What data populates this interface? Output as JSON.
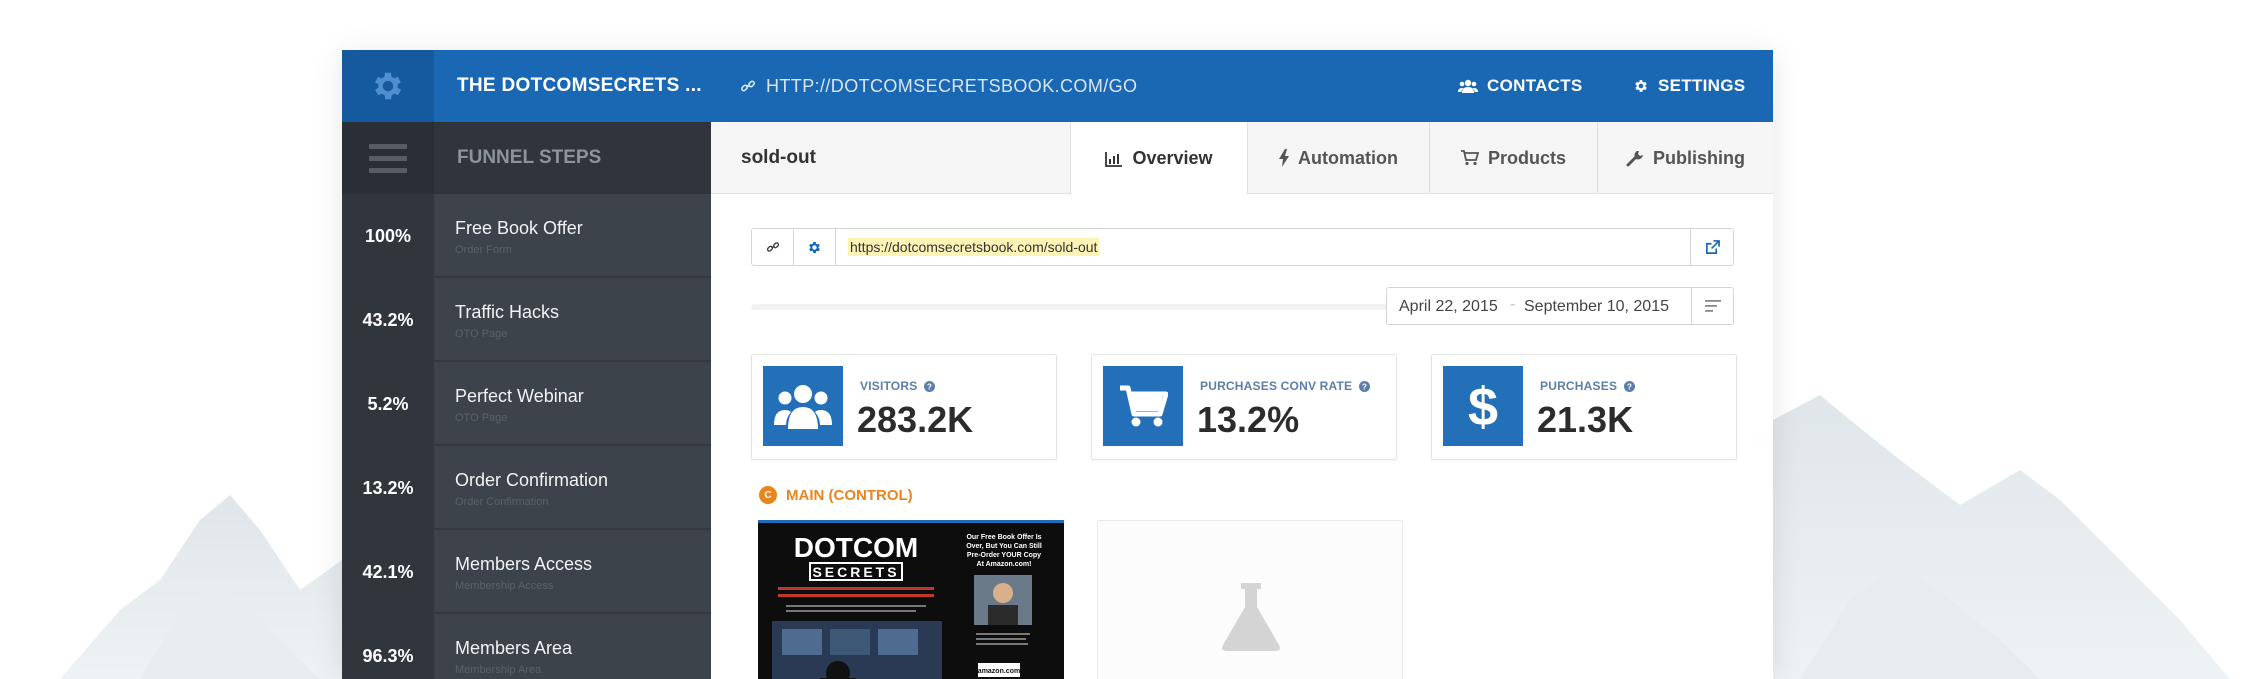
{
  "header": {
    "funnel_title": "THE DOTCOMSECRETS ...",
    "funnel_url": "HTTP://DOTCOMSECRETSBOOK.COM/GO",
    "contacts_label": "CONTACTS",
    "settings_label": "SETTINGS"
  },
  "sidebar": {
    "heading": "FUNNEL STEPS",
    "steps": [
      {
        "percent": "100%",
        "name": "Free Book Offer",
        "type": "Order Form"
      },
      {
        "percent": "43.2%",
        "name": "Traffic Hacks",
        "type": "OTO Page"
      },
      {
        "percent": "5.2%",
        "name": "Perfect Webinar",
        "type": "OTO Page"
      },
      {
        "percent": "13.2%",
        "name": "Order Confirmation",
        "type": "Order Confirmation"
      },
      {
        "percent": "42.1%",
        "name": "Members Access",
        "type": "Membership Access"
      },
      {
        "percent": "96.3%",
        "name": "Members Area",
        "type": "Membership Area"
      }
    ]
  },
  "page": {
    "name": "sold-out",
    "tabs": [
      {
        "label": "Overview",
        "icon": "bar-chart-icon",
        "active": true
      },
      {
        "label": "Automation",
        "icon": "bolt-icon",
        "active": false
      },
      {
        "label": "Products",
        "icon": "cart-icon",
        "active": false
      },
      {
        "label": "Publishing",
        "icon": "wrench-icon",
        "active": false
      }
    ],
    "url": "https://dotcomsecretsbook.com/sold-out",
    "date_start": "April 22, 2015",
    "date_end": "September 10, 2015"
  },
  "stats": [
    {
      "label": "VISITORS",
      "value": "283.2K",
      "icon": "users-icon"
    },
    {
      "label": "PURCHASES CONV RATE",
      "value": "13.2%",
      "icon": "cart-icon"
    },
    {
      "label": "PURCHASES",
      "value": "21.3K",
      "icon": "dollar-icon"
    }
  ],
  "variant": {
    "badge": "C",
    "label": "MAIN (CONTROL)"
  },
  "thumbnail": {
    "logo_top": "DOTCOM",
    "logo_bottom": "SECRETS",
    "offer_text": "Our Free Book Offer Is Over, But You Can Still Pre-Order YOUR Copy At Amazon.com!",
    "amazon": "amazon.com"
  },
  "colors": {
    "brand_blue": "#1a67b3",
    "sidebar_dark": "#3d434a",
    "accent_orange": "#e8851c",
    "highlight_yellow": "#fcf3b5"
  }
}
